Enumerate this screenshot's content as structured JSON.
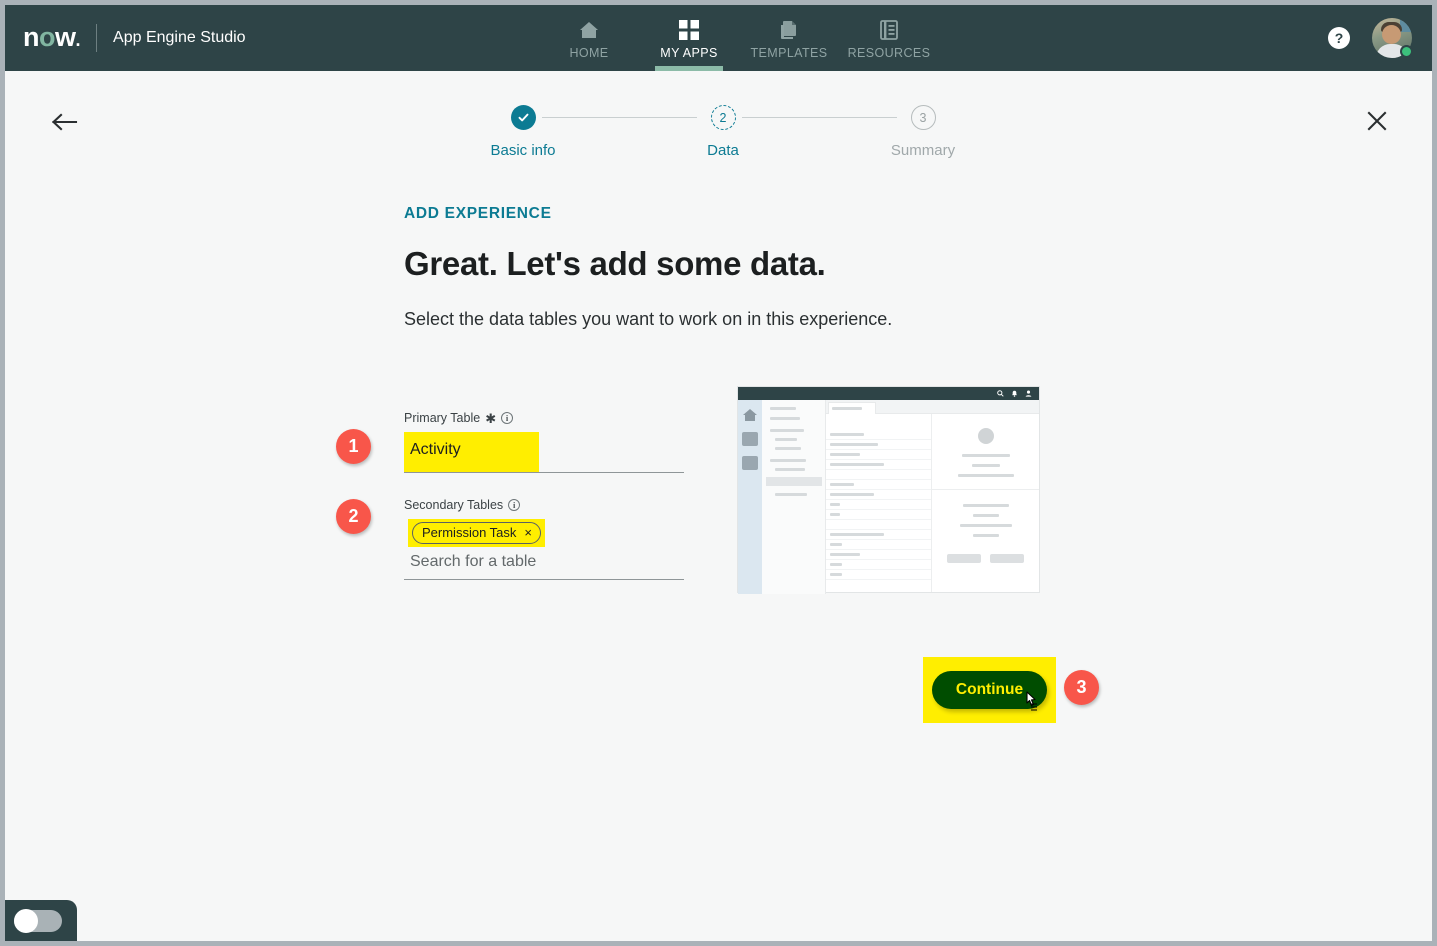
{
  "topbar": {
    "logo": "now",
    "app_title": "App Engine Studio",
    "nav": [
      {
        "label": "HOME",
        "icon": "home-icon",
        "active": false
      },
      {
        "label": "MY APPS",
        "icon": "grid-icon",
        "active": true
      },
      {
        "label": "TEMPLATES",
        "icon": "copy-icon",
        "active": false
      },
      {
        "label": "RESOURCES",
        "icon": "document-icon",
        "active": false
      }
    ],
    "help_label": "?",
    "help_icon": "help-icon",
    "avatar_icon": "user-avatar",
    "status": "online"
  },
  "page_head": {
    "back_icon": "arrow-left-icon",
    "close_icon": "close-icon"
  },
  "stepper": {
    "steps": [
      {
        "marker": "✓",
        "label": "Basic info",
        "state": "done"
      },
      {
        "marker": "2",
        "label": "Data",
        "state": "current"
      },
      {
        "marker": "3",
        "label": "Summary",
        "state": "todo"
      }
    ]
  },
  "content": {
    "eyebrow": "ADD EXPERIENCE",
    "headline": "Great. Let's add some data.",
    "subhead": "Select the data tables you want to work on in this experience."
  },
  "form": {
    "primary": {
      "label": "Primary Table",
      "required_mark": "✱",
      "info_icon": "info-icon",
      "info_glyph": "i",
      "value": "Activity"
    },
    "secondary": {
      "label": "Secondary Tables",
      "info_icon": "info-icon",
      "info_glyph": "i",
      "chips": [
        {
          "label": "Permission Task",
          "remove_icon": "×"
        }
      ],
      "placeholder": "Search for a table"
    }
  },
  "callouts": [
    {
      "number": "1"
    },
    {
      "number": "2"
    },
    {
      "number": "3"
    }
  ],
  "preview": {
    "name": "experience-preview-thumbnail",
    "icons": [
      "search-icon",
      "bell-icon",
      "user-icon"
    ]
  },
  "footer": {
    "continue_label": "Continue",
    "cursor_icon": "pointer-cursor-icon",
    "toggle_icon": "toggle-switch",
    "toggle_state": "off"
  },
  "colors": {
    "nav_bg": "#2e4447",
    "accent_teal": "#0c7b93",
    "highlight_yellow": "#ffee00",
    "badge_red": "#f8564a",
    "button_green": "#004d00",
    "active_underline": "#8cbba8",
    "status_green": "#3cc07c"
  }
}
